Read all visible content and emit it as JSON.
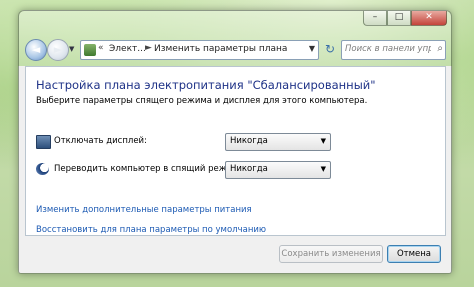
{
  "window": {
    "caption": {
      "minimize": "–",
      "maximize": "□",
      "close": "✕"
    }
  },
  "nav": {
    "back_glyph": "◄",
    "forward_glyph": "►",
    "dropdown_glyph": "▼",
    "breadcrumb": [
      "Элект...",
      "Изменить параметры плана"
    ],
    "breadcrumb_sep": "►",
    "leading_sep": "«",
    "refresh_glyph": "↻",
    "search_placeholder": "Поиск в панели управления",
    "search_icon": "magnifier-icon"
  },
  "main": {
    "title": "Настройка плана электропитания \"Сбалансированный\"",
    "subtitle": "Выберите параметры спящего режима и дисплея для этого компьютера.",
    "settings": [
      {
        "label": "Отключать дисплей:",
        "value": "Никогда",
        "icon": "monitor-icon"
      },
      {
        "label": "Переводить компьютер в спящий режим:",
        "value": "Никогда",
        "icon": "moon-icon"
      }
    ],
    "links": [
      "Изменить дополнительные параметры питания",
      "Восстановить для плана параметры по умолчанию"
    ]
  },
  "footer": {
    "save_label": "Сохранить изменения",
    "save_enabled": false,
    "cancel_label": "Отмена"
  },
  "colors": {
    "title": "#1e3287",
    "link": "#1c5ab3",
    "accent_button_border": "#3c7fb1"
  }
}
